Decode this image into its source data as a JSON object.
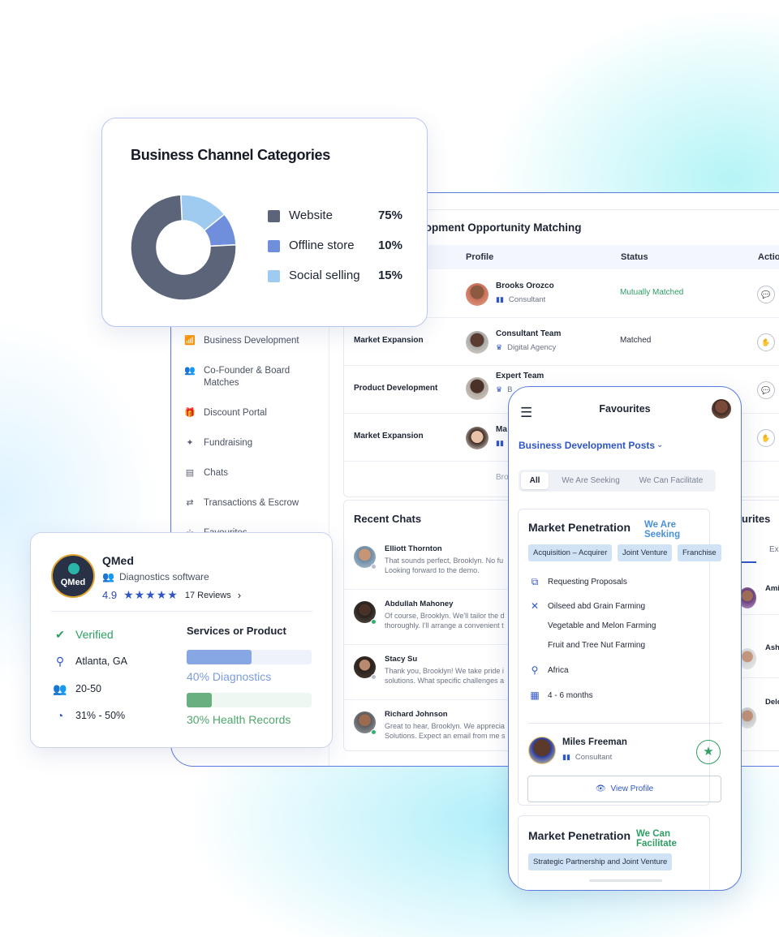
{
  "dashboard": {
    "sidebar": {
      "items": [
        {
          "label": "Business Development",
          "icon": "chart-icon"
        },
        {
          "label": "Co-Founder & Board Matches",
          "icon": "people-icon"
        },
        {
          "label": "Discount Portal",
          "icon": "gift-icon"
        },
        {
          "label": "Fundraising",
          "icon": "hands-icon"
        },
        {
          "label": "Chats",
          "icon": "chat-icon"
        },
        {
          "label": "Transactions & Escrow",
          "icon": "transfer-icon"
        },
        {
          "label": "Favourites",
          "icon": "star-icon"
        }
      ]
    },
    "table": {
      "title": "lopment Opportunity Matching",
      "headers": {
        "profile": "Profile",
        "status": "Status",
        "action": "Actio"
      },
      "rows": [
        {
          "category": "",
          "name": "Brooks Orozco",
          "role": "Consultant",
          "status": "Mutually Matched"
        },
        {
          "category": "Market Expansion",
          "name": "Consultant Team",
          "role": "Digital Agency",
          "status": "Matched"
        },
        {
          "category": "Product Development",
          "name": "Expert Team",
          "role": "B",
          "status": ""
        },
        {
          "category": "Market Expansion",
          "name": "Ma",
          "role": "",
          "status": ""
        },
        {
          "category": "",
          "name": "Bro",
          "role": "",
          "status": ""
        }
      ]
    },
    "chats": {
      "title": "Recent Chats",
      "items": [
        {
          "name": "Elliott Thornton",
          "message": "That sounds perfect, Brooklyn. No fu Looking forward to the demo."
        },
        {
          "name": "Abdullah Mahoney",
          "message": "Of course, Brooklyn. We'll tailor the d thoroughly. I'll arrange a convenient t"
        },
        {
          "name": "Stacy Su",
          "message": "Thank you, Brooklyn! We take pride i solutions. What specific challenges a"
        },
        {
          "name": "Richard Johnson",
          "message": "Great to hear, Brooklyn. We apprecia Solutions. Expect an email from me s"
        }
      ]
    },
    "favourites": {
      "title": "ourites",
      "tabs": [
        "ll",
        "Ex"
      ],
      "names": [
        "Ami",
        "Ashe",
        "Delo"
      ]
    }
  },
  "channel_card": {
    "title": "Business Channel Categories",
    "chart_data": {
      "type": "pie",
      "categories": [
        "Website",
        "Offline store",
        "Social selling"
      ],
      "values": [
        75,
        10,
        15
      ],
      "value_labels": [
        "75%",
        "10%",
        "15%"
      ],
      "colors": [
        "#5b6478",
        "#6f8fdd",
        "#9fcbf1"
      ]
    }
  },
  "qmed": {
    "logo_text": "QMed",
    "name": "QMed",
    "category": "Diagnostics software",
    "rating": "4.9",
    "stars": "★★★★★",
    "reviews": "17 Reviews",
    "verified": "Verified",
    "location": "Atlanta, GA",
    "team_size": "20-50",
    "growth": "31% - 50%",
    "services_title": "Services or Product",
    "services": [
      {
        "label": "40% Diagnostics",
        "percent": 0.52,
        "fill": "#86a7e4",
        "track": "#eef3fb",
        "text_color": "#7c9be0"
      },
      {
        "label": "30% Health Records",
        "percent": 0.2,
        "fill": "#68b07f",
        "track": "#eef7f1",
        "text_color": "#4fa66e"
      }
    ]
  },
  "phone": {
    "title": "Favourites",
    "select": "Business Development Posts",
    "segments": [
      "All",
      "We Are Seeking",
      "We Can Facilitate"
    ],
    "post1": {
      "title": "Market Penetration",
      "tag": "We Are Seeking",
      "chips": [
        "Acquisition – Acquirer",
        "Joint Venture",
        "Franchise"
      ],
      "requesting": "Requesting Proposals",
      "industries": [
        "Oilseed abd Grain Farming",
        "Vegetable and Melon Farming",
        "Fruit and Tree Nut Farming"
      ],
      "region": "Africa",
      "timeline": "4 - 6 months",
      "person": "Miles Freeman",
      "role": "Consultant",
      "view_profile": "View Profile"
    },
    "post2": {
      "title": "Market Penetration",
      "tag": "We Can Facilitate",
      "chips": [
        "Strategic Partnership and Joint Venture"
      ]
    }
  }
}
